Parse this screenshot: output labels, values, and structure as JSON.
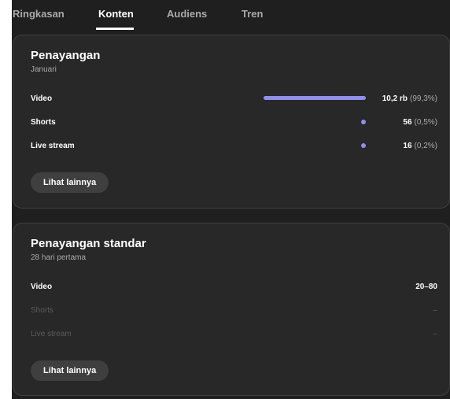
{
  "colors": {
    "background": "#1f1f1f",
    "card": "#282828",
    "accent": "#8d8ff0",
    "text_secondary": "#aaaaaa"
  },
  "tabs": [
    {
      "label": "Ringkasan",
      "active": false
    },
    {
      "label": "Konten",
      "active": true
    },
    {
      "label": "Audiens",
      "active": false
    },
    {
      "label": "Tren",
      "active": false
    }
  ],
  "views_card": {
    "title": "Penayangan",
    "subtitle": "Januari",
    "rows": [
      {
        "label": "Video",
        "value": "10,2 rb",
        "percent": "(99,3%)",
        "share": 0.993
      },
      {
        "label": "Shorts",
        "value": "56",
        "percent": "(0,5%)",
        "share": 0.005
      },
      {
        "label": "Live stream",
        "value": "16",
        "percent": "(0,2%)",
        "share": 0.002
      }
    ],
    "more_button": "Lihat lainnya"
  },
  "standard_views_card": {
    "title": "Penayangan standar",
    "subtitle": "28 hari pertama",
    "rows": [
      {
        "label": "Video",
        "value": "20–80"
      },
      {
        "label": "Shorts",
        "value": "–"
      },
      {
        "label": "Live stream",
        "value": "–"
      }
    ],
    "more_button": "Lihat lainnya"
  }
}
